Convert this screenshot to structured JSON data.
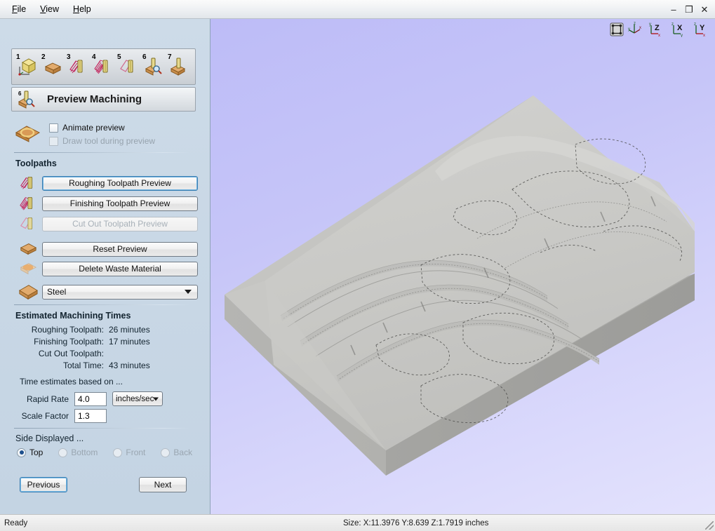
{
  "window": {
    "menu": [
      {
        "label": "File",
        "mnemonic": "F"
      },
      {
        "label": "View",
        "mnemonic": "V"
      },
      {
        "label": "Help",
        "mnemonic": "H"
      }
    ],
    "controls": {
      "minimize": "–",
      "maximize": "❐",
      "close": "✕"
    }
  },
  "steps": {
    "items": [
      {
        "num": "1",
        "icon": "cube-axes-icon",
        "name": "step-1-model"
      },
      {
        "num": "2",
        "icon": "material-block-icon",
        "name": "step-2-material"
      },
      {
        "num": "3",
        "icon": "roughing-toolpath-icon",
        "name": "step-3-roughing"
      },
      {
        "num": "4",
        "icon": "finishing-toolpath-icon",
        "name": "step-4-finishing"
      },
      {
        "num": "5",
        "icon": "cutout-toolpath-icon",
        "name": "step-5-cutout"
      },
      {
        "num": "6",
        "icon": "preview-magnifier-icon",
        "name": "step-6-preview"
      },
      {
        "num": "7",
        "icon": "save-block-icon",
        "name": "step-7-save"
      }
    ],
    "current": {
      "num": "6",
      "title": "Preview Machining"
    }
  },
  "preview_options": {
    "animate": {
      "label": "Animate preview",
      "checked": false,
      "disabled": false
    },
    "draw_tool": {
      "label": "Draw tool during preview",
      "checked": false,
      "disabled": true
    }
  },
  "toolpaths": {
    "section_label": "Toolpaths",
    "buttons": [
      {
        "label": "Roughing Toolpath Preview",
        "state": "focus",
        "icon": "roughing-toolpath-icon"
      },
      {
        "label": "Finishing Toolpath Preview",
        "state": "normal",
        "icon": "finishing-toolpath-icon"
      },
      {
        "label": "Cut Out Toolpath Preview",
        "state": "disabled",
        "icon": "cutout-toolpath-icon"
      }
    ],
    "reset_preview": {
      "label": "Reset Preview",
      "icon": "material-block-icon"
    },
    "delete_waste": {
      "label": "Delete Waste Material",
      "icon": "waste-material-icon"
    },
    "material": {
      "selected": "Steel",
      "icon": "material-swatch-icon"
    }
  },
  "estimates": {
    "section_label": "Estimated Machining Times",
    "rows": [
      {
        "label": "Roughing Toolpath:",
        "value": "26 minutes"
      },
      {
        "label": "Finishing Toolpath:",
        "value": "17 minutes"
      },
      {
        "label": "Cut Out Toolpath:",
        "value": ""
      },
      {
        "label": "Total Time:",
        "value": "43 minutes"
      }
    ],
    "note": "Time estimates based on ...",
    "rapid_rate": {
      "label": "Rapid Rate",
      "value": "4.0",
      "units": "inches/sec"
    },
    "scale_factor": {
      "label": "Scale Factor",
      "value": "1.3"
    }
  },
  "side_displayed": {
    "section_label": "Side Displayed ...",
    "options": [
      {
        "label": "Top",
        "selected": true,
        "disabled": false
      },
      {
        "label": "Bottom",
        "selected": false,
        "disabled": true
      },
      {
        "label": "Front",
        "selected": false,
        "disabled": true
      },
      {
        "label": "Back",
        "selected": false,
        "disabled": true
      }
    ]
  },
  "navigation": {
    "previous": "Previous",
    "next": "Next"
  },
  "viewport": {
    "background_color": "#c8c7f8",
    "model_color": "#c9c9c6",
    "tools": [
      {
        "name": "fit-to-view-icon",
        "label": ""
      },
      {
        "name": "isometric-view-icon",
        "label": ""
      },
      {
        "name": "top-view-z-icon",
        "label": "Z"
      },
      {
        "name": "front-view-x-icon",
        "label": "X"
      },
      {
        "name": "side-view-y-icon",
        "label": "Y"
      }
    ]
  },
  "statusbar": {
    "ready": "Ready",
    "size": "Size: X:11.3976 Y:8.639 Z:1.7919 inches"
  }
}
